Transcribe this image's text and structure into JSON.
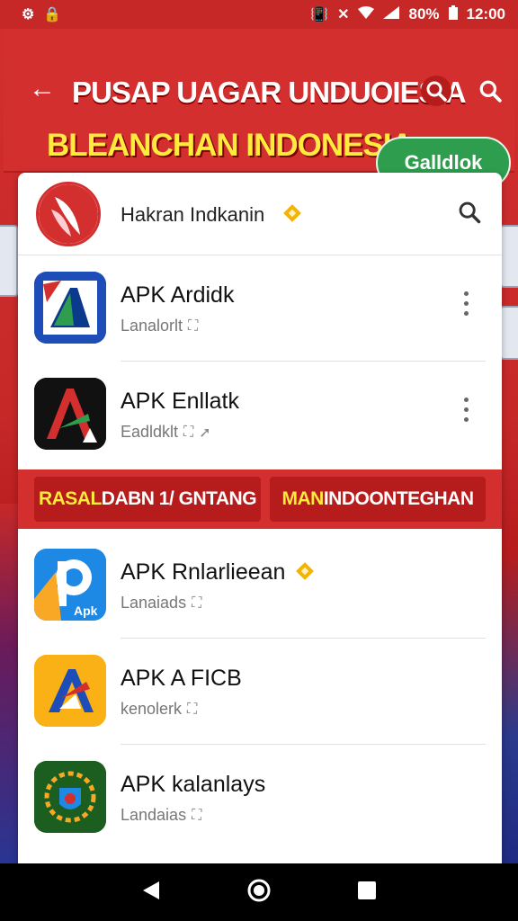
{
  "status_bar": {
    "left_icons": [
      "settings-icon",
      "lock-icon"
    ],
    "battery": "80%",
    "time": "12:00"
  },
  "header": {
    "title_line1": "PUSAP UAGAR UNDUOIESIA",
    "title_line2": "BLEANCHAN INDONESIA",
    "action_button": "Galldlok",
    "colors": {
      "background": "#d32f2f",
      "title_accent": "#ffeb3b",
      "button": "#2e9e4e"
    }
  },
  "search": {
    "label": "Hakran Indkanin",
    "badge_icon": "verified-diamond-icon"
  },
  "apps_top": [
    {
      "name": "APK Ardidk",
      "sub": "Lanalorlt"
    },
    {
      "name": "APK Enllatk",
      "sub": "Eadldklt"
    }
  ],
  "banner_strip": {
    "left": {
      "highlight": "RASAL",
      "rest": " DABN 1/ GNTANG"
    },
    "right": {
      "highlight": "MAN",
      "rest": " INDOONTEGHAN"
    }
  },
  "apps_bottom": [
    {
      "name": "APK Rnlarlieean",
      "sub": "Lanaiads",
      "verified": true
    },
    {
      "name": "APK A FICB",
      "sub": "kenolerk"
    },
    {
      "name": "APK kalanlays",
      "sub": "Landaias"
    }
  ],
  "nav": [
    "back-icon",
    "home-icon",
    "recents-icon"
  ]
}
